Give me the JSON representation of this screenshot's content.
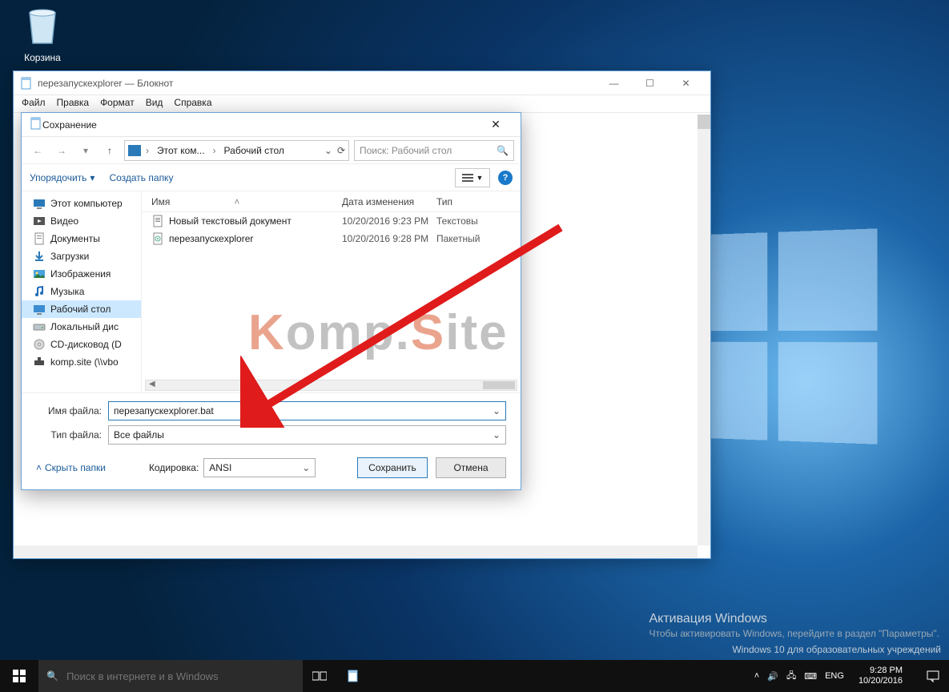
{
  "desktop": {
    "recycle_bin": "Корзина"
  },
  "watermark": {
    "title": "Активация Windows",
    "line": "Чтобы активировать Windows, перейдите в раздел \"Параметры\".",
    "edu": "Windows 10 для образовательных учреждений"
  },
  "taskbar": {
    "search_placeholder": "Поиск в интернете и в Windows",
    "lang": "ENG",
    "time": "9:28 PM",
    "date": "10/20/2016"
  },
  "notepad": {
    "title": "перезапускexplorer — Блокнот",
    "menu": {
      "file": "Файл",
      "edit": "Правка",
      "format": "Формат",
      "view": "Вид",
      "help": "Справка"
    }
  },
  "dialog": {
    "title": "Сохранение",
    "breadcrumb": {
      "root": "Этот ком...",
      "leaf": "Рабочий стол"
    },
    "search_placeholder": "Поиск: Рабочий стол",
    "toolbar": {
      "organize": "Упорядочить",
      "newfolder": "Создать папку"
    },
    "columns": {
      "name": "Имя",
      "date": "Дата изменения",
      "type": "Тип"
    },
    "tree": [
      {
        "label": "Этот компьютер",
        "icon": "pc"
      },
      {
        "label": "Видео",
        "icon": "video"
      },
      {
        "label": "Документы",
        "icon": "docs"
      },
      {
        "label": "Загрузки",
        "icon": "downloads"
      },
      {
        "label": "Изображения",
        "icon": "pictures"
      },
      {
        "label": "Музыка",
        "icon": "music"
      },
      {
        "label": "Рабочий стол",
        "icon": "desktop",
        "selected": true
      },
      {
        "label": "Локальный дис",
        "icon": "drive"
      },
      {
        "label": "CD-дисковод (D",
        "icon": "cd"
      },
      {
        "label": "komp.site (\\\\vbo",
        "icon": "net"
      }
    ],
    "files": [
      {
        "name": "Новый текстовый документ",
        "date": "10/20/2016 9:23 PM",
        "type": "Текстовы",
        "icon": "txt"
      },
      {
        "name": "перезапускexplorer",
        "date": "10/20/2016 9:28 PM",
        "type": "Пакетный",
        "icon": "bat"
      }
    ],
    "filename_label": "Имя файла:",
    "filename_value": "перезапускexplorer.bat",
    "filetype_label": "Тип файла:",
    "filetype_value": "Все файлы",
    "hide_folders": "Скрыть папки",
    "encoding_label": "Кодировка:",
    "encoding_value": "ANSI",
    "save": "Сохранить",
    "cancel": "Отмена"
  },
  "overlay_text": "Komp.Site"
}
